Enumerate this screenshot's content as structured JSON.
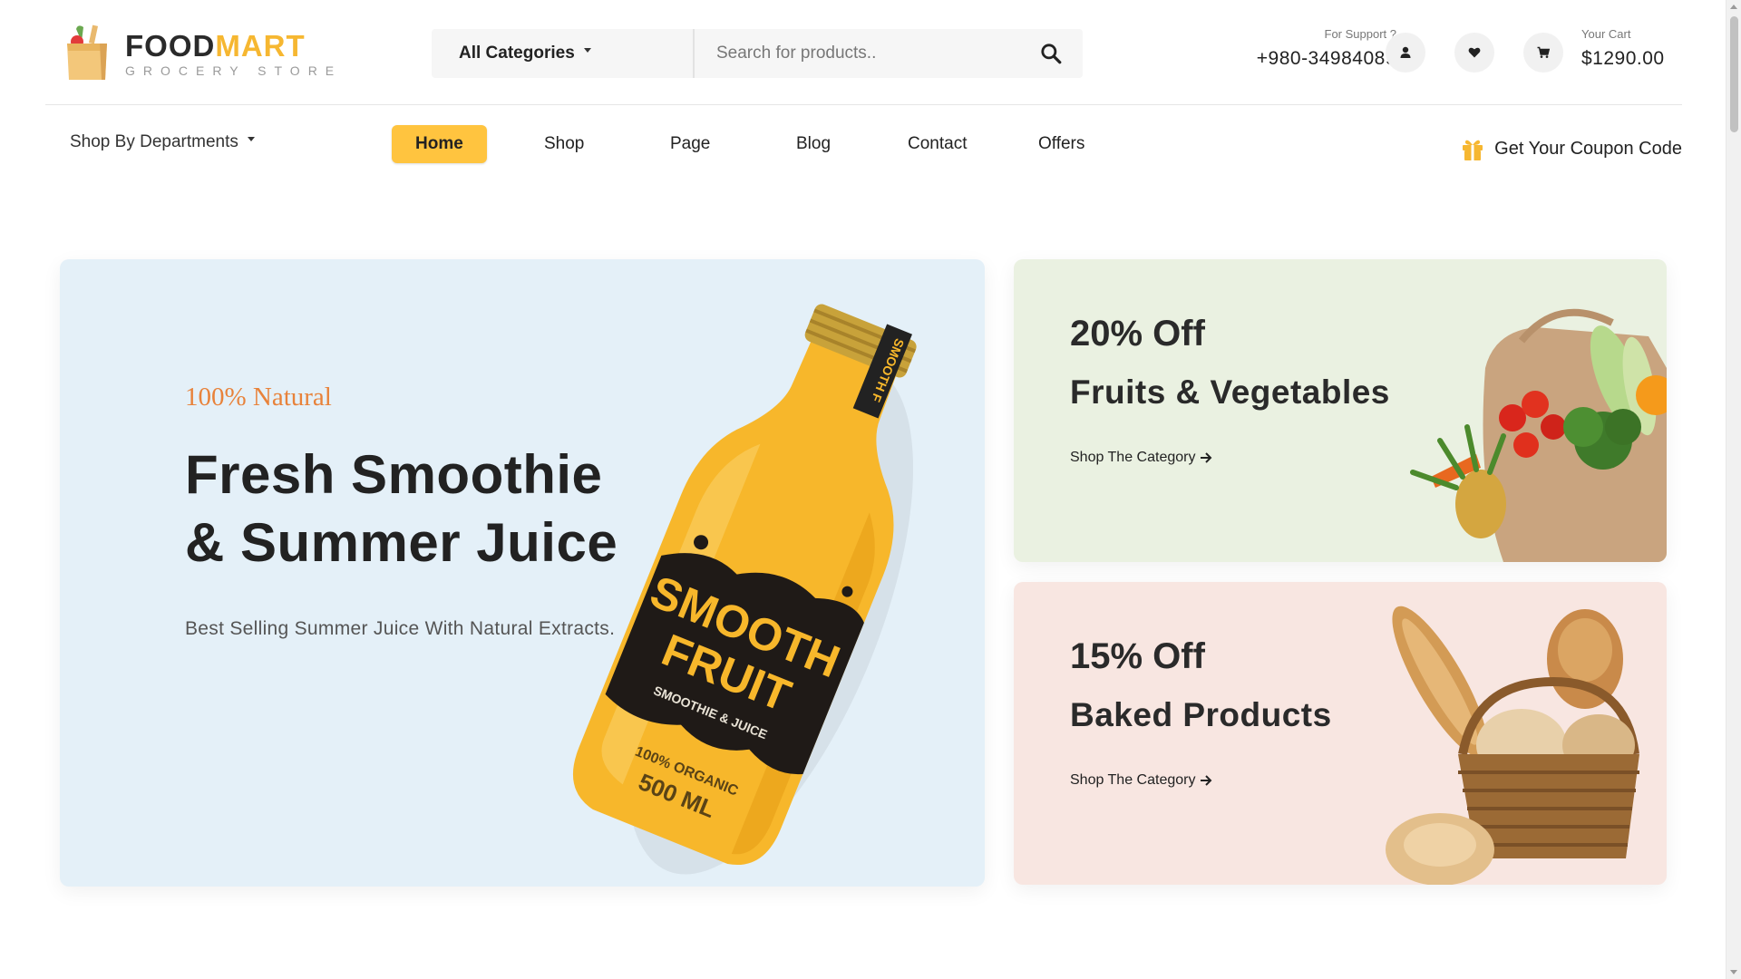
{
  "logo": {
    "brand_part1": "FOOD",
    "brand_part2": "MART",
    "tagline": "GROCERY STORE"
  },
  "search": {
    "category_label": "All Categories",
    "placeholder": "Search for products.."
  },
  "support": {
    "label": "For Support ?",
    "phone": "+980-34984089"
  },
  "header_icons": [
    "user-icon",
    "heart-icon",
    "cart-icon"
  ],
  "cart": {
    "label": "Your Cart",
    "total": "$1290.00"
  },
  "nav": {
    "departments_label": "Shop By Departments",
    "items": [
      {
        "label": "Home",
        "active": true
      },
      {
        "label": "Shop"
      },
      {
        "label": "Page"
      },
      {
        "label": "Blog"
      },
      {
        "label": "Contact"
      },
      {
        "label": "Offers"
      }
    ],
    "coupon_label": "Get Your Coupon Code"
  },
  "hero": {
    "eyebrow": "100% Natural",
    "title": "Fresh Smoothie & Summer Juice",
    "subtitle": "Best Selling Summer Juice With Natural Extracts.",
    "bottle_label_line1": "SMOOTH",
    "bottle_label_line2": "FRUIT",
    "bottle_label_small": "SMOOTHIE & JUICE",
    "bottle_organic": "100% ORGANIC",
    "bottle_volume": "500 ML",
    "bottle_cap_label": "SMOOTH F"
  },
  "promos": [
    {
      "discount": "20% Off",
      "title": "Fruits & Vegetables",
      "link": "Shop The Category"
    },
    {
      "discount": "15% Off",
      "title": "Baked Products",
      "link": "Shop The Category"
    }
  ],
  "colors": {
    "accent": "#ffc43f",
    "brand_yellow": "#f6b731",
    "eyebrow_orange": "#e8823a",
    "hero_bg": "#e4f0f8",
    "promo1_bg": "#eaf1e1",
    "promo2_bg": "#f8e6e1"
  }
}
